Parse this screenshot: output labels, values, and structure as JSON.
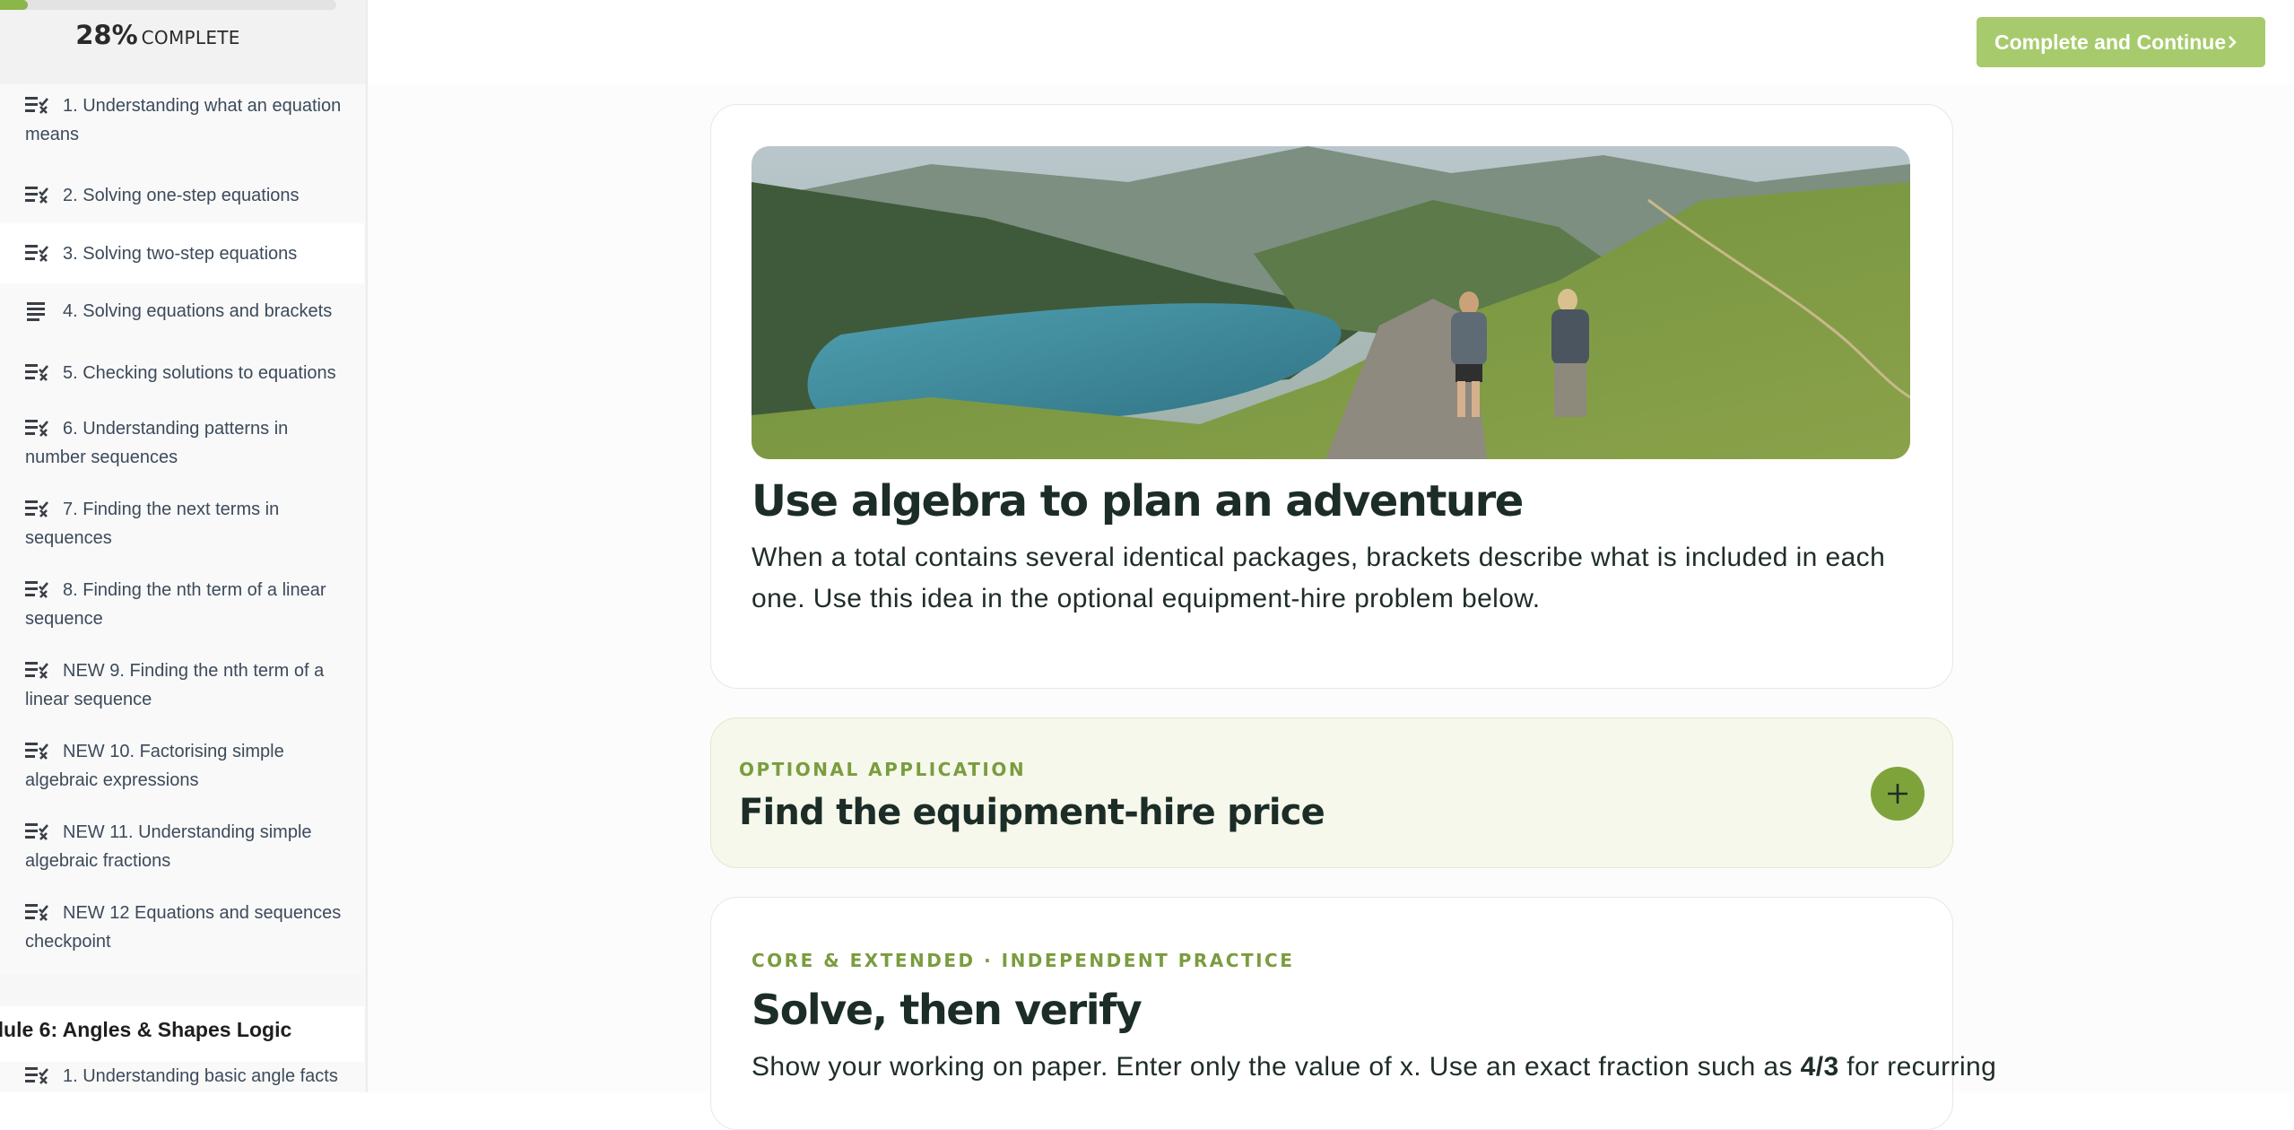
{
  "progress": {
    "percent": 28,
    "percent_label": "28%",
    "word": "COMPLETE"
  },
  "sidebar": {
    "lessons": [
      {
        "label": "1. Understanding what an equation means",
        "icon": "quiz-icon"
      },
      {
        "label": "2. Solving one-step equations",
        "icon": "quiz-icon"
      },
      {
        "label": "3. Solving two-step equations",
        "icon": "quiz-icon",
        "active": true
      },
      {
        "label": "4. Solving equations and brackets",
        "icon": "text-lines-icon"
      },
      {
        "label": "5. Checking solutions to equations",
        "icon": "quiz-icon"
      },
      {
        "label": "6. Understanding patterns in number sequences",
        "icon": "quiz-icon"
      },
      {
        "label": "7. Finding the next terms in sequences",
        "icon": "quiz-icon"
      },
      {
        "label": "8. Finding the nth term of a linear sequence",
        "icon": "quiz-icon"
      },
      {
        "label": "NEW 9. Finding the nth term of a linear sequence",
        "icon": "quiz-icon"
      },
      {
        "label": "NEW 10. Factorising simple algebraic expressions",
        "icon": "quiz-icon"
      },
      {
        "label": "NEW 11. Understanding simple algebraic fractions",
        "icon": "quiz-icon"
      },
      {
        "label": "NEW 12 Equations and sequences checkpoint",
        "icon": "quiz-icon"
      }
    ],
    "module_title": "dule 6: Angles & Shapes Logic",
    "next_lesson": {
      "label": "1. Understanding basic angle facts",
      "icon": "quiz-icon"
    }
  },
  "topbar": {
    "continue_label": "Complete and Continue",
    "continue_icon": "chevron-right-icon"
  },
  "intro": {
    "title": "Use algebra to plan an adventure",
    "text": "When a total contains several identical packages, brackets describe what is included in each one. Use this idea in the optional equipment-hire problem below."
  },
  "optional": {
    "eyebrow": "OPTIONAL APPLICATION",
    "title": "Find the equipment-hire price",
    "expand_icon": "plus-icon"
  },
  "practice": {
    "eyebrow": "CORE & EXTENDED · INDEPENDENT PRACTICE",
    "title": "Solve, then verify",
    "text_before": "Show your working on paper. Enter only the value of x. Use an exact fraction such as ",
    "text_bold": "4/3",
    "text_after": " for recurring"
  },
  "colors": {
    "accent": "#a7cb6c",
    "accent_dark": "#7fa33b",
    "eyebrow": "#7b9c3f",
    "heading": "#1c2d28"
  }
}
